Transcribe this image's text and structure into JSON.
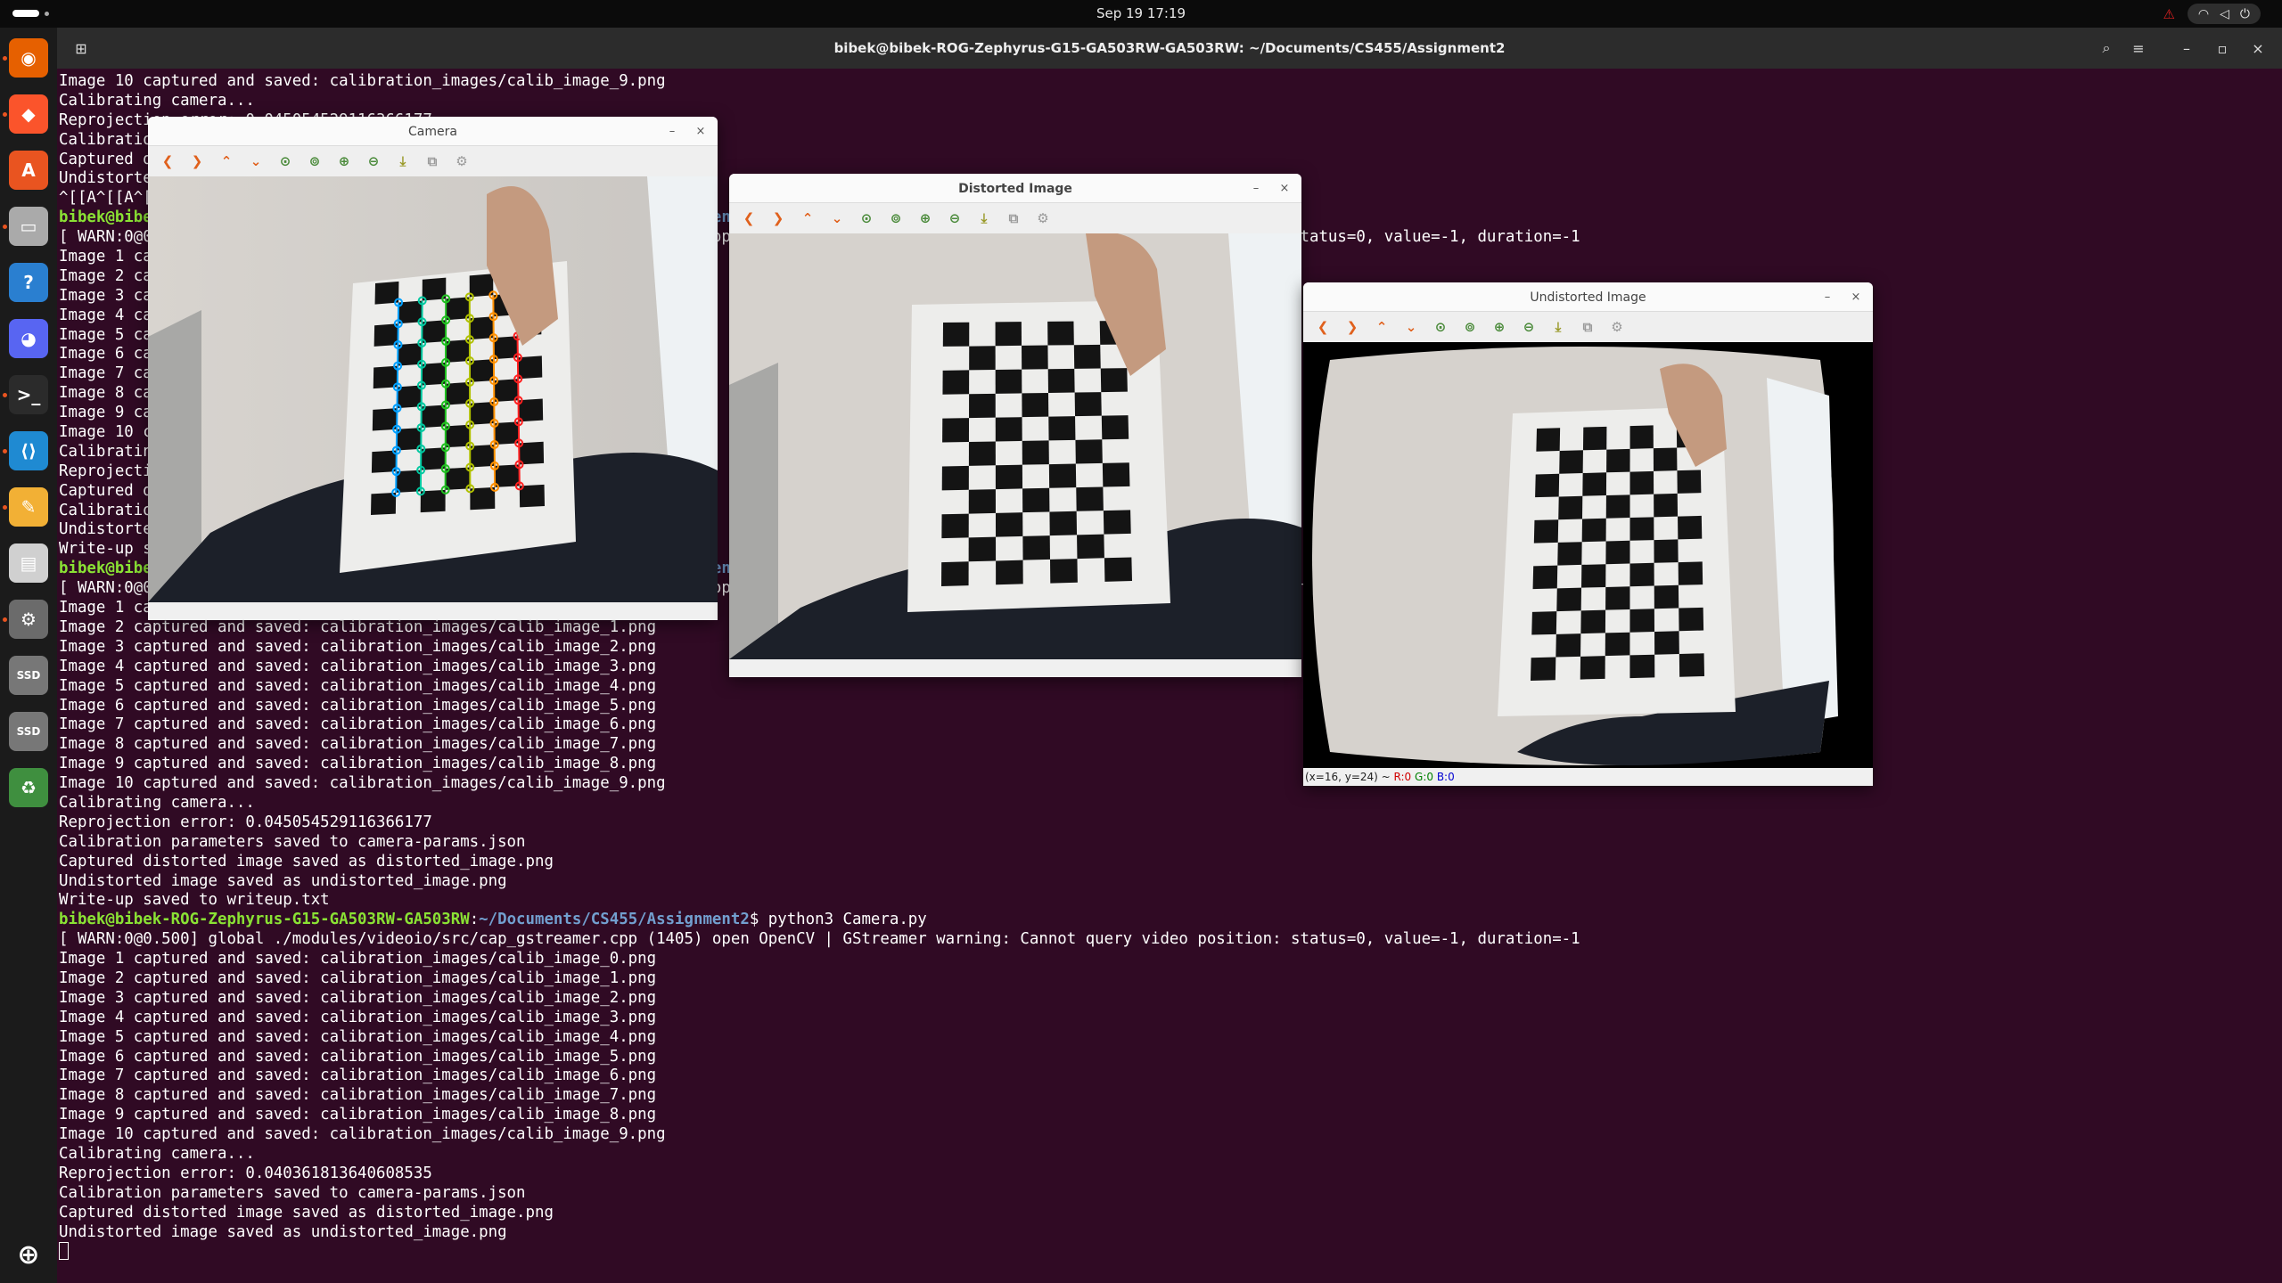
{
  "topbar": {
    "clock": "Sep 19  17:19",
    "warning_icon": "warning-icon",
    "tray_icons": [
      "wifi-icon",
      "volume-icon",
      "power-icon"
    ]
  },
  "dock": {
    "apps": [
      {
        "name": "firefox",
        "glyph": "◉",
        "color": "#e66000"
      },
      {
        "name": "brave",
        "glyph": "◆",
        "color": "#fb542b"
      },
      {
        "name": "app-center",
        "glyph": "A",
        "color": "#e95420"
      },
      {
        "name": "files",
        "glyph": "▭",
        "color": "#aaaaaa"
      },
      {
        "name": "help",
        "glyph": "?",
        "color": "#2a7fd0"
      },
      {
        "name": "discord",
        "glyph": "◕",
        "color": "#5865f2"
      },
      {
        "name": "terminal",
        "glyph": ">_",
        "color": "#2b2b2b"
      },
      {
        "name": "vscode",
        "glyph": "⟨⟩",
        "color": "#1f8ad2"
      },
      {
        "name": "text-editor",
        "glyph": "✎",
        "color": "#f2b035"
      },
      {
        "name": "document",
        "glyph": "▤",
        "color": "#d0d0d0"
      },
      {
        "name": "settings",
        "glyph": "⚙",
        "color": "#6b6b6b"
      },
      {
        "name": "ssd-1",
        "glyph": "SSD",
        "color": "#777777"
      },
      {
        "name": "ssd-2",
        "glyph": "SSD",
        "color": "#777777"
      },
      {
        "name": "trash",
        "glyph": "♻",
        "color": "#3f8f3f"
      }
    ],
    "show_apps": "⊕"
  },
  "terminal": {
    "title": "bibek@bibek-ROG-Zephyrus-G15-GA503RW-GA503RW: ~/Documents/CS455/Assignment2",
    "lines": [
      "Image 10 captured and saved: calibration_images/calib_image_9.png",
      "Calibrating camera...",
      "Reprojection error: 0.045054529116366177",
      "Calibration parameters saved to camera-params.json",
      "Captured distorted image saved as distorted_image.png",
      "Undistorted image saved as undistorted_image.png",
      "^[[A^[[A^[[A",
      {
        "user": "bibek@bibek-ROG-Zephyrus-G15-GA503RW-GA503RW",
        "path": "~/Documents/CS455/Assignment2",
        "cmd": "$ python3 Camera.py"
      },
      "[ WARN:0@0.500] global ./modules/videoio/src/cap_gstreamer.cpp (1405) open OpenCV | GStreamer warning: Cannot query video position: status=0, value=-1, duration=-1",
      "Image 1 captured and saved: calibration_images/calib_image_0.png",
      "Image 2 captured and saved: calibration_images/calib_image_1.png",
      "Image 3 captured and saved: calibration_images/calib_image_2.png",
      "Image 4 captured and saved: calibration_images/calib_image_3.png",
      "Image 5 captured and saved: calibration_images/calib_image_4.png",
      "Image 6 captured and saved: calibration_images/calib_image_5.png",
      "Image 7 captured and saved: calibration_images/calib_image_6.png",
      "Image 8 captured and saved: calibration_images/calib_image_7.png",
      "Image 9 captured and saved: calibration_images/calib_image_8.png",
      "Image 10 captured and saved: calibration_images/calib_image_9.png",
      "Calibrating camera...",
      "Reprojection error: 0.045054529116366177",
      "Captured distorted image saved as distorted_image.png",
      "Calibration parameters saved to camera-params.json",
      "Undistorted image saved as undistorted_image.png",
      "Write-up saved to writeup.txt",
      {
        "user": "bibek@bibek-ROG-Zephyrus-G15-GA503RW-GA503RW",
        "path": "~/Documents/CS455/Assignment2",
        "cmd": "$ python3 Camera.py"
      },
      "[ WARN:0@0.500] global ./modules/videoio/src/cap_gstreamer.cpp (1405) open OpenCV | GStreamer warning: Cannot query video position: status=0, value=-1, duration=-1",
      "Image 1 captured and saved: calibration_images/calib_image_0.png",
      "Image 2 captured and saved: calibration_images/calib_image_1.png",
      "Image 3 captured and saved: calibration_images/calib_image_2.png",
      "Image 4 captured and saved: calibration_images/calib_image_3.png",
      "Image 5 captured and saved: calibration_images/calib_image_4.png",
      "Image 6 captured and saved: calibration_images/calib_image_5.png",
      "Image 7 captured and saved: calibration_images/calib_image_6.png",
      "Image 8 captured and saved: calibration_images/calib_image_7.png",
      "Image 9 captured and saved: calibration_images/calib_image_8.png",
      "Image 10 captured and saved: calibration_images/calib_image_9.png",
      "Calibrating camera...",
      "Reprojection error: 0.045054529116366177",
      "Calibration parameters saved to camera-params.json",
      "Captured distorted image saved as distorted_image.png",
      "Undistorted image saved as undistorted_image.png",
      "Write-up saved to writeup.txt",
      {
        "user": "bibek@bibek-ROG-Zephyrus-G15-GA503RW-GA503RW",
        "path": "~/Documents/CS455/Assignment2",
        "cmd": "$ python3 Camera.py"
      },
      "[ WARN:0@0.500] global ./modules/videoio/src/cap_gstreamer.cpp (1405) open OpenCV | GStreamer warning: Cannot query video position: status=0, value=-1, duration=-1",
      "Image 1 captured and saved: calibration_images/calib_image_0.png",
      "Image 2 captured and saved: calibration_images/calib_image_1.png",
      "Image 3 captured and saved: calibration_images/calib_image_2.png",
      "Image 4 captured and saved: calibration_images/calib_image_3.png",
      "Image 5 captured and saved: calibration_images/calib_image_4.png",
      "Image 6 captured and saved: calibration_images/calib_image_5.png",
      "Image 7 captured and saved: calibration_images/calib_image_6.png",
      "Image 8 captured and saved: calibration_images/calib_image_7.png",
      "Image 9 captured and saved: calibration_images/calib_image_8.png",
      "Image 10 captured and saved: calibration_images/calib_image_9.png",
      "Calibrating camera...",
      "Reprojection error: 0.040361813640608535",
      "Calibration parameters saved to camera-params.json",
      "Captured distorted image saved as distorted_image.png",
      "Undistorted image saved as undistorted_image.png"
    ]
  },
  "windows": {
    "camera": {
      "title": "Camera"
    },
    "distorted": {
      "title": "Distorted Image"
    },
    "undistorted": {
      "title": "Undistorted Image",
      "status_prefix": "(x=16, y=24) ~ ",
      "status_r": "R:0",
      "status_g": "G:0",
      "status_b": "B:0"
    }
  },
  "viewer_toolbar": [
    {
      "name": "pan-left-icon",
      "glyph": "❮",
      "c": "o"
    },
    {
      "name": "pan-right-icon",
      "glyph": "❯",
      "c": "o"
    },
    {
      "name": "pan-up-icon",
      "glyph": "⌃",
      "c": "o"
    },
    {
      "name": "pan-down-icon",
      "glyph": "⌄",
      "c": "o"
    },
    {
      "name": "zoom-reset-icon",
      "glyph": "⊙",
      "c": "g"
    },
    {
      "name": "zoom-fit-icon",
      "glyph": "⊚",
      "c": "g"
    },
    {
      "name": "zoom-in-icon",
      "glyph": "⊕",
      "c": "g"
    },
    {
      "name": "zoom-out-icon",
      "glyph": "⊖",
      "c": "g"
    },
    {
      "name": "save-icon",
      "glyph": "⤓",
      "c": "y"
    },
    {
      "name": "copy-icon",
      "glyph": "⧉",
      "c": "s"
    },
    {
      "name": "properties-icon",
      "glyph": "⚙",
      "c": "s"
    }
  ],
  "colors": {
    "terminal_bg": "#300a24",
    "prompt_user": "#8ae234",
    "prompt_path": "#729fcf",
    "accent": "#e95420"
  }
}
